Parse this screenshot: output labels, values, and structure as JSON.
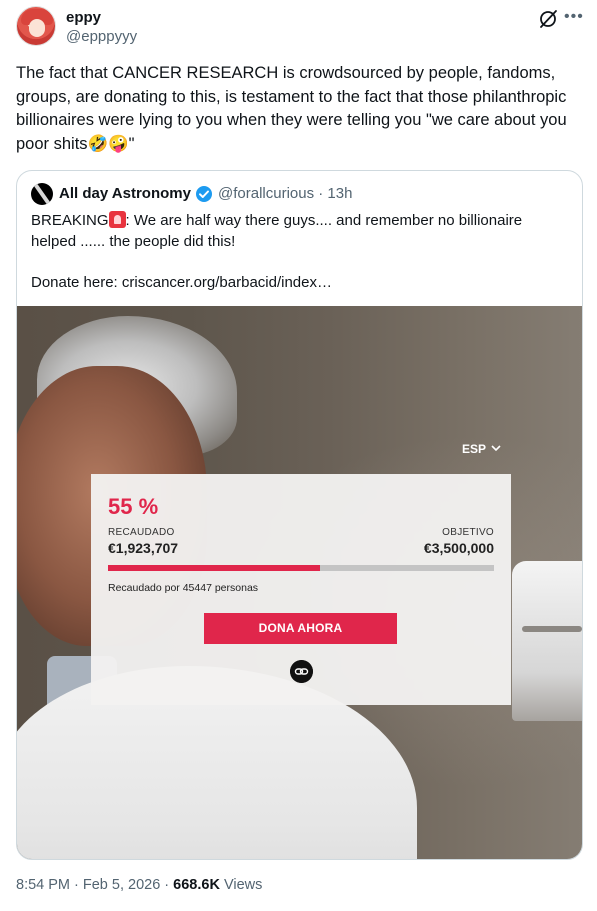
{
  "author": {
    "name": "eppy",
    "handle": "@epppyyy"
  },
  "tweet": {
    "text": "The fact that CANCER RESEARCH is crowdsourced by people, fandoms, groups, are donating to this, is testament to the fact that those philanthropic billionaires were lying to you when they were telling you \"we care about you poor shits🤣🤪\""
  },
  "quote": {
    "name": "All day Astronomy",
    "handle_time": "@forallcurious · 13h",
    "text_before_emoji": "BREAKING",
    "text_after_emoji": ": We are half way there guys.... and remember no billionaire helped ...... the people did this!",
    "donate_line": "Donate here: criscancer.org/barbacid/index…"
  },
  "media": {
    "language": "ESP",
    "percent_label": "55 %",
    "raised_label": "RECAUDADO",
    "goal_label": "OBJETIVO",
    "raised_amount": "€1,923,707",
    "goal_amount": "€3,500,000",
    "progress_fraction": 0.55,
    "raised_by": "Recaudado por 45447 personas",
    "donate_button": "DONA AHORA"
  },
  "footer": {
    "time_date": "8:54 PM · Feb 5, 2026 · ",
    "views_count": "668.6K",
    "views_label": " Views"
  },
  "colors": {
    "accent_red": "#e0264b",
    "verified_blue": "#1d9bf0",
    "muted_text": "#536471"
  }
}
